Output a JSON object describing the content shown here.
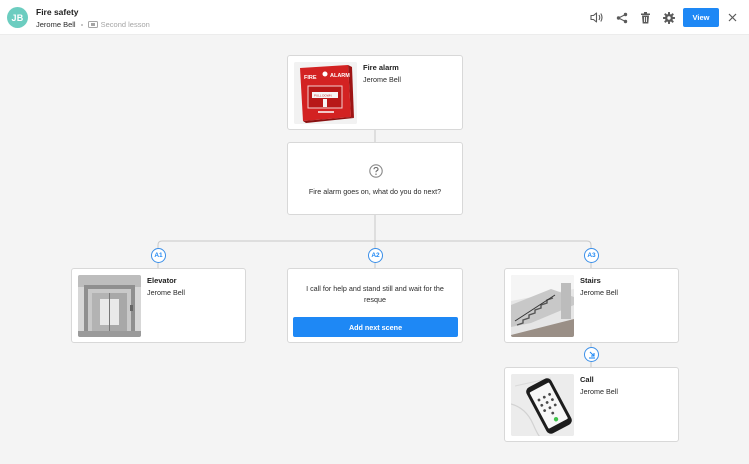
{
  "header": {
    "avatar_initials": "JB",
    "title": "Fire safety",
    "author": "Jerome Bell",
    "lesson": "Second lesson",
    "view_label": "View",
    "icons": [
      "audio-icon",
      "share-icon",
      "trash-icon",
      "gear-icon",
      "close-icon"
    ]
  },
  "colors": {
    "accent": "#1e88f5",
    "avatar": "#6ccdc0",
    "background": "#f4f4f4"
  },
  "root_scene": {
    "title": "Fire alarm",
    "author": "Jerome Bell",
    "thumbnail_text": {
      "line1": "FIRE",
      "line2": "ALARM",
      "line3": "PULL DOWN"
    }
  },
  "question": {
    "text": "Fire alarm goes on, what do you do next?"
  },
  "answers": [
    {
      "badge": "A1",
      "type": "scene",
      "title": "Elevator",
      "author": "Jerome Bell"
    },
    {
      "badge": "A2",
      "type": "text",
      "text": "I call for help and stand still and wait for the resque",
      "button_label": "Add next scene"
    },
    {
      "badge": "A3",
      "type": "scene",
      "title": "Stairs",
      "author": "Jerome Bell"
    }
  ],
  "followup_scene": {
    "title": "Call",
    "author": "Jerome Bell"
  }
}
